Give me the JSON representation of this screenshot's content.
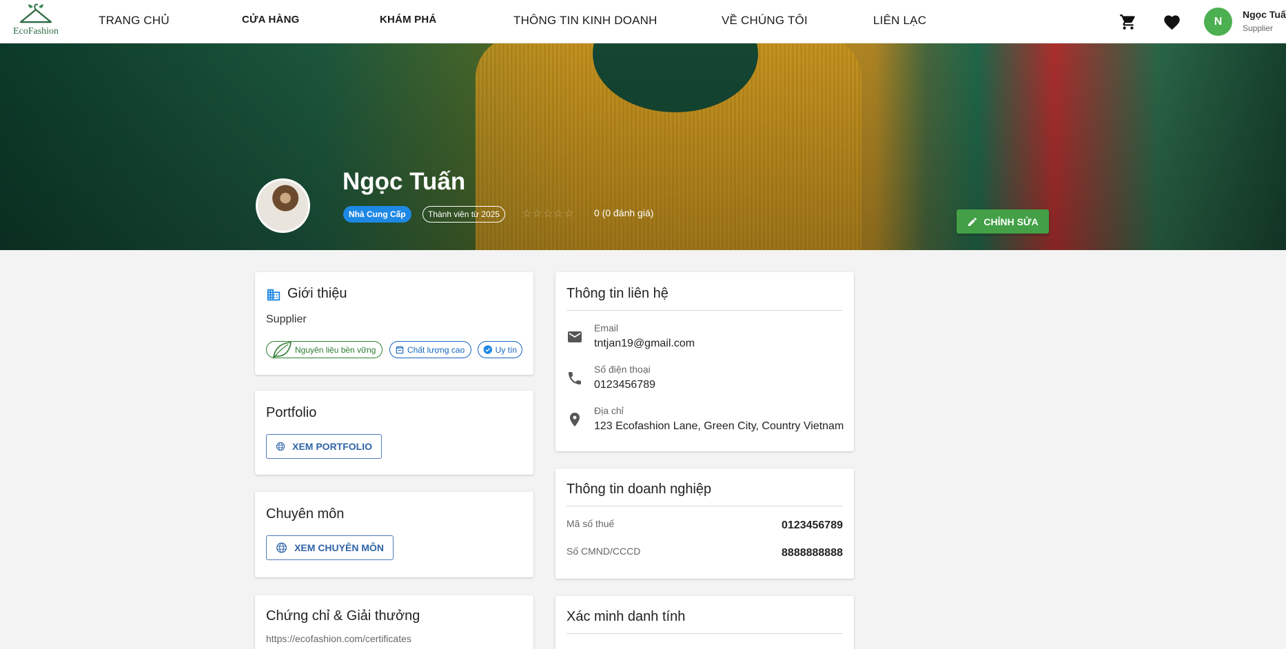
{
  "brand": {
    "name": "EcoFashion",
    "color": "#2e6b46"
  },
  "nav": {
    "home": "TRANG CHỦ",
    "shop": "CỬA HÀNG",
    "explore": "KHÁM PHÁ",
    "business": "THÔNG TIN KINH DOANH",
    "about": "VỀ CHÚNG TÔI",
    "contact": "LIÊN LẠC"
  },
  "header_icons": [
    "cart-icon",
    "heart-icon"
  ],
  "user": {
    "initial": "N",
    "name": "Ngọc Tuấn",
    "role": "Supplier"
  },
  "profile": {
    "name": "Ngọc Tuấn",
    "role_badge": "Nhà Cung Cấp",
    "member_since": "Thành viên từ 2025",
    "rating_text": "0 (0 đánh giá)",
    "rating_stars": 0,
    "edit_label": "CHỈNH SỬA"
  },
  "intro": {
    "title": "Giới thiệu",
    "text": "Supplier",
    "chips": [
      "Nguyên liệu bền vững",
      "Chất lượng cao",
      "Uy tín"
    ]
  },
  "portfolio": {
    "title": "Portfolio",
    "button": "XEM PORTFOLIO"
  },
  "expertise": {
    "title": "Chuyên môn",
    "button": "XEM CHUYÊN MÔN"
  },
  "certificates": {
    "title": "Chứng chỉ & Giải thưởng",
    "link": "https://ecofashion.com/certificates"
  },
  "contact": {
    "title": "Thông tin liên hệ",
    "email_label": "Email",
    "email": "tntjan19@gmail.com",
    "phone_label": "Số điện thoại",
    "phone": "0123456789",
    "address_label": "Địa chỉ",
    "address": "123 Ecofashion Lane, Green City, Country Vietnam"
  },
  "business": {
    "title": "Thông tin doanh nghiệp",
    "tax_label": "Mã số thuế",
    "tax": "0123456789",
    "id_label": "Số CMND/CCCD",
    "id": "8888888888"
  },
  "verify": {
    "title": "Xác minh danh tính"
  },
  "colors": {
    "primary": "#1e88e5",
    "success": "#43a047",
    "chip_green": "#2e7d32",
    "chip_blue": "#1565c0"
  }
}
